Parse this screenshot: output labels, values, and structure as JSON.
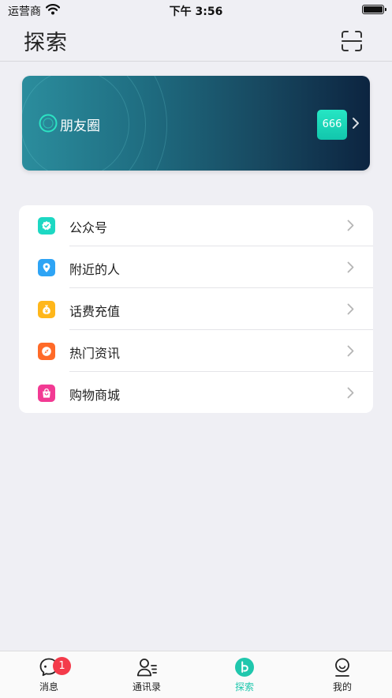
{
  "status_bar": {
    "carrier": "运营商",
    "time": "下午 3:56"
  },
  "header": {
    "title": "探索"
  },
  "banner": {
    "label": "朋友圈",
    "badge": "666"
  },
  "menu": [
    {
      "label": "公众号",
      "icon": "verified-badge-icon",
      "color": "#1dd8c3"
    },
    {
      "label": "附近的人",
      "icon": "location-pin-icon",
      "color": "#2ea4f5"
    },
    {
      "label": "话费充值",
      "icon": "money-bag-icon",
      "color": "#ffb71b"
    },
    {
      "label": "热门资讯",
      "icon": "compass-icon",
      "color": "#ff6a28"
    },
    {
      "label": "购物商城",
      "icon": "shopping-bag-icon",
      "color": "#f23a93"
    }
  ],
  "tabs": [
    {
      "label": "消息",
      "badge": "1"
    },
    {
      "label": "通讯录"
    },
    {
      "label": "探索",
      "active": true
    },
    {
      "label": "我的"
    }
  ],
  "colors": {
    "accent": "#20c7ad",
    "badge_red": "#f43b4b",
    "background": "#efeff4"
  }
}
